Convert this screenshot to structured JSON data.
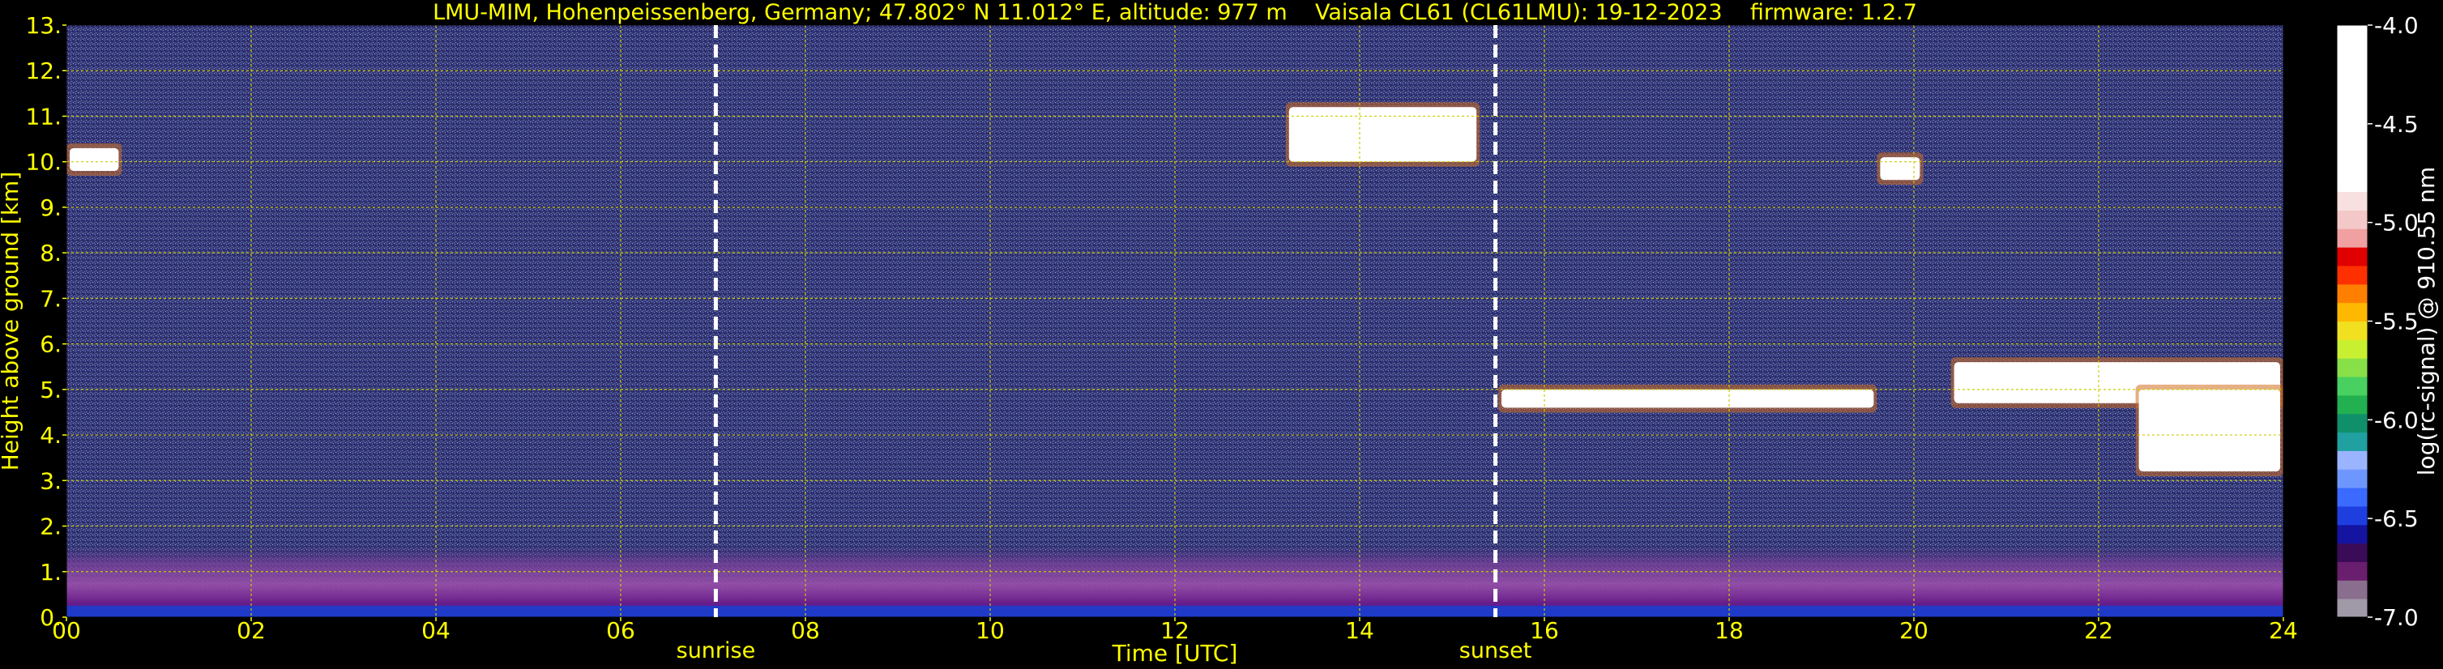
{
  "chart_data": {
    "type": "heatmap",
    "title": "LMU-MIM, Hohenpeissenberg, Germany; 47.802° N 11.012° E, altitude: 977 m    Vaisala CL61 (CL61LMU): 19-12-2023    firmware: 1.2.7",
    "xlabel": "Time [UTC]",
    "ylabel": "Height above ground [km]",
    "colorbar_label": "log(rc-signal) @ 910.55 nm",
    "xlim": [
      0,
      24
    ],
    "ylim": [
      0,
      13
    ],
    "clim": [
      -7.0,
      -4.0
    ],
    "x_ticks": [
      "00",
      "02",
      "04",
      "06",
      "08",
      "10",
      "12",
      "14",
      "16",
      "18",
      "20",
      "22",
      "24"
    ],
    "y_ticks": [
      "0.",
      "1.",
      "2.",
      "3.",
      "4.",
      "5.",
      "6.",
      "7.",
      "8.",
      "9.",
      "10.",
      "11.",
      "12.",
      "13."
    ],
    "colorbar_ticks": [
      "-7.0",
      "-6.5",
      "-6.0",
      "-5.5",
      "-5.0",
      "-4.5",
      "-4.0"
    ],
    "grid": true,
    "sun_events": [
      {
        "label": "sunrise",
        "time": 7.03
      },
      {
        "label": "sunset",
        "time": 15.47
      }
    ],
    "cloud_features": [
      {
        "time_start": 13.2,
        "time_end": 15.3,
        "height_bottom": 10.0,
        "height_top": 11.2
      },
      {
        "time_start": 15.5,
        "time_end": 19.6,
        "height_bottom": 4.6,
        "height_top": 5.0
      },
      {
        "time_start": 20.4,
        "time_end": 24.0,
        "height_bottom": 4.7,
        "height_top": 5.6
      },
      {
        "time_start": 22.4,
        "time_end": 24.0,
        "height_bottom": 3.2,
        "height_top": 5.0
      },
      {
        "time_start": 19.6,
        "time_end": 20.1,
        "height_bottom": 9.6,
        "height_top": 10.1
      },
      {
        "time_start": 0.0,
        "time_end": 0.6,
        "height_bottom": 9.8,
        "height_top": 10.3
      }
    ],
    "colors": {
      "background": "#000000",
      "text": "#ffff00",
      "grid": "#cccc00",
      "colorbar_text": "#ffffff",
      "sun_line": "#ffffff",
      "plot_background": "#35387a"
    }
  }
}
